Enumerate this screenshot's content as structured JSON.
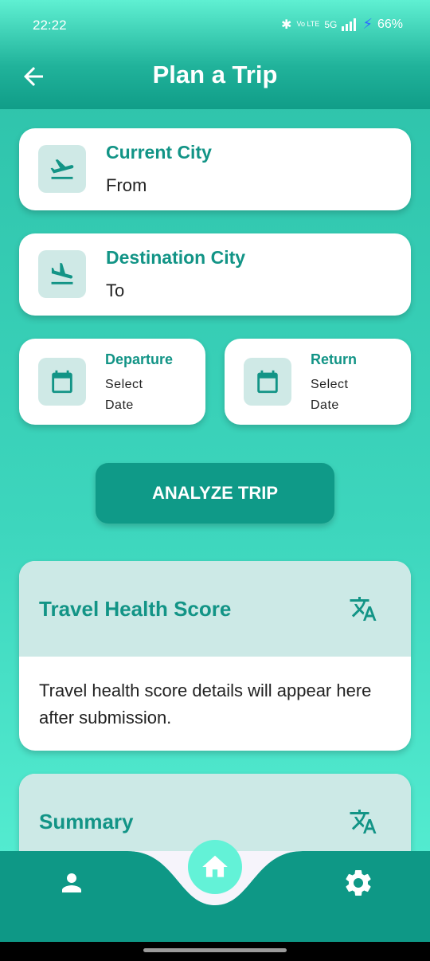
{
  "status": {
    "time": "22:22",
    "battery": "66%",
    "network": "5G",
    "volte": "Vo LTE"
  },
  "header": {
    "title": "Plan a Trip"
  },
  "current_city": {
    "label": "Current City",
    "value": "From"
  },
  "destination_city": {
    "label": "Destination City",
    "value": "To"
  },
  "departure": {
    "label": "Departure",
    "value": "Select Date"
  },
  "return_date": {
    "label": "Return",
    "value": "Select Date"
  },
  "analyze_button": {
    "label": "ANALYZE TRIP"
  },
  "health_panel": {
    "title": "Travel Health Score",
    "body": "Travel health score details will appear here after submission."
  },
  "summary_panel": {
    "title": "Summary"
  },
  "icons": {
    "back": "arrow-left-icon",
    "takeoff": "flight-takeoff-icon",
    "land": "flight-land-icon",
    "calendar": "calendar-icon",
    "translate": "translate-icon",
    "profile": "person-icon",
    "home": "home-icon",
    "settings": "gear-icon"
  },
  "colors": {
    "accent": "#129486",
    "button": "#0f9a88",
    "icon_box": "#cfe9e6",
    "nav": "#0e9886",
    "home_fab": "#63f2d7"
  }
}
